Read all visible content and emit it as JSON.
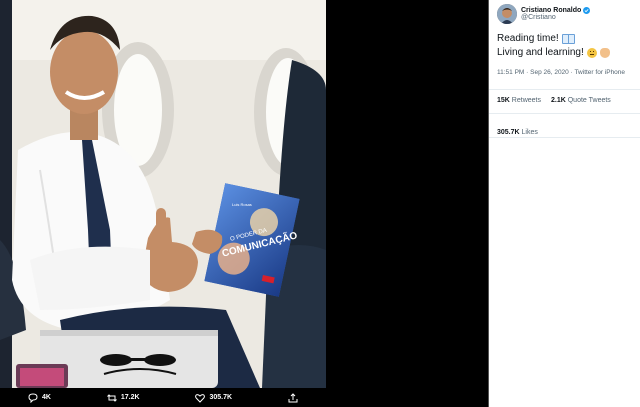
{
  "tweet": {
    "author_name": "Cristiano Ronaldo",
    "author_handle": "@Cristiano",
    "line1": "Reading time!",
    "line2": "Living and learning!",
    "timestamp": "11:51 PM · Sep 26, 2020 · Twitter for iPhone",
    "retweets_count": "15K",
    "retweets_label": "Retweets",
    "quotes_count": "2.1K",
    "quotes_label": "Quote Tweets",
    "likes_count": "305.7K",
    "likes_label": "Likes"
  },
  "actions": {
    "replies": "4K",
    "retweets": "17.2K",
    "likes": "305.7K"
  },
  "book": {
    "top_text": "Luis Rosas",
    "title_small": "O PODER DA",
    "title_big": "COMUNICAÇÃO"
  },
  "colors": {
    "verified": "#1d9bf0",
    "text_primary": "#0f1419",
    "text_secondary": "#536471"
  },
  "icons": [
    "reply-icon",
    "retweet-icon",
    "like-icon",
    "share-icon",
    "verified-icon",
    "book-emoji",
    "wink-emoji",
    "clap-emoji"
  ]
}
